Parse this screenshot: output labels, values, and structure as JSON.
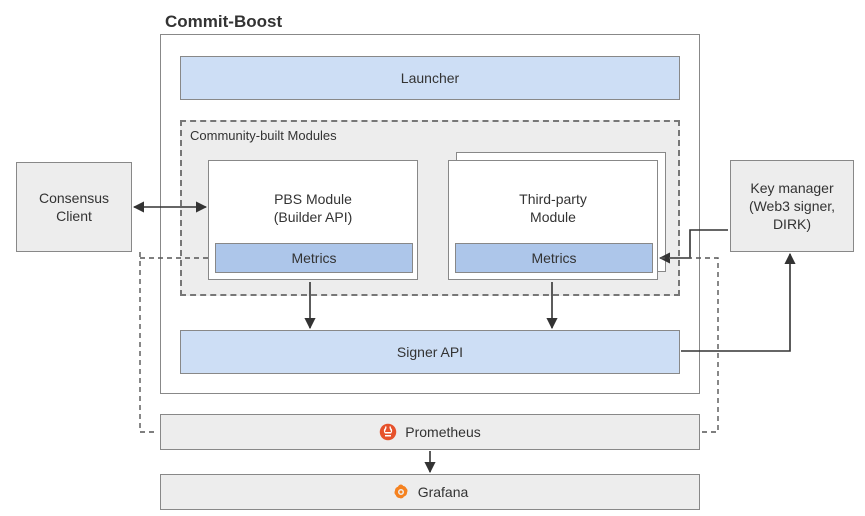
{
  "title": "Commit-Boost",
  "components": {
    "launcher": "Launcher",
    "modules_group": "Community-built Modules",
    "pbs_module": {
      "title": "PBS Module",
      "subtitle": "(Builder API)",
      "metrics": "Metrics"
    },
    "thirdparty_module": {
      "title": "Third-party",
      "subtitle": "Module",
      "metrics": "Metrics"
    },
    "signer": "Signer API",
    "prometheus": "Prometheus",
    "grafana": "Grafana"
  },
  "externals": {
    "consensus": {
      "l1": "Consensus",
      "l2": "Client"
    },
    "keymanager": {
      "l1": "Key manager",
      "l2": "(Web3 signer,",
      "l3": "DIRK)"
    }
  },
  "colors": {
    "blue_light": "#cddef5",
    "blue_dark": "#adc6ea",
    "gray": "#ededed"
  },
  "icons": {
    "prometheus": "prometheus-icon",
    "grafana": "grafana-icon"
  }
}
